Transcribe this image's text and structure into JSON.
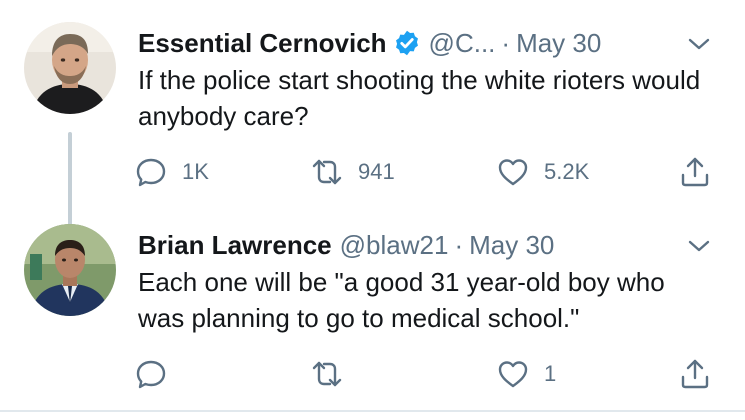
{
  "tweets": [
    {
      "author_name": "Essential Cernovich",
      "verified": true,
      "handle": "@C...",
      "separator": "·",
      "date": "May 30",
      "text": "If the police start shooting the white rioters would anybody care?",
      "reply_count": "1K",
      "retweet_count": "941",
      "like_count": "5.2K"
    },
    {
      "author_name": "Brian Lawrence",
      "verified": false,
      "handle": "@blaw21",
      "separator": "·",
      "date": "May 30",
      "text": "Each one will be \"a good 31 year-old boy who was planning to go to medical school.\"",
      "reply_count": "",
      "retweet_count": "",
      "like_count": "1"
    }
  ],
  "icons": {
    "reply": "reply-icon",
    "retweet": "retweet-icon",
    "like": "heart-icon",
    "share": "share-icon",
    "more": "chevron-down-icon",
    "verified": "verified-badge-icon"
  },
  "colors": {
    "text": "#14171a",
    "muted": "#5b7083",
    "verified": "#1da1f2",
    "thread_line": "#c4cfd6"
  }
}
